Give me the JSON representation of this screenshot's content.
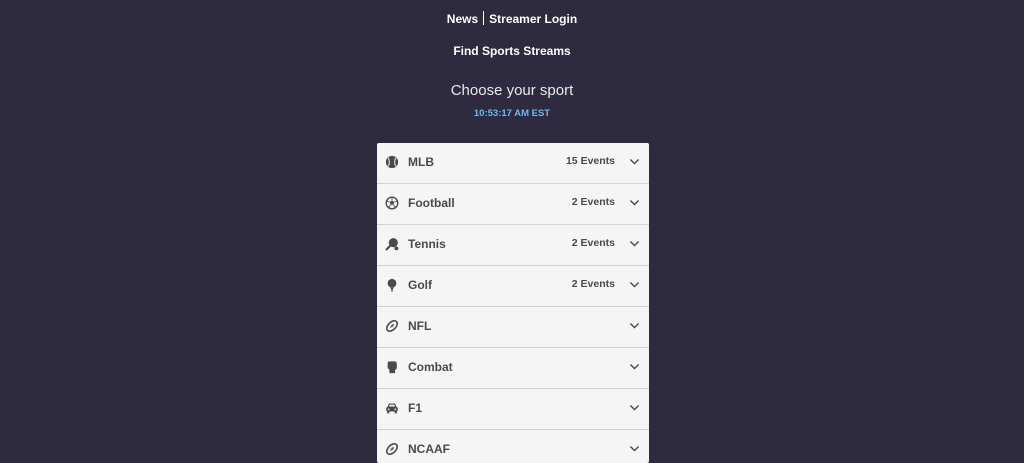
{
  "nav": {
    "news": "News",
    "streamer_login": "Streamer Login",
    "find_streams": "Find Sports Streams"
  },
  "main": {
    "heading": "Choose your sport",
    "clock": "10:53:17 AM EST"
  },
  "sports": [
    {
      "label": "MLB",
      "count": "15 Events",
      "icon": "baseball-icon"
    },
    {
      "label": "Football",
      "count": "2 Events",
      "icon": "soccer-ball-icon"
    },
    {
      "label": "Tennis",
      "count": "2 Events",
      "icon": "racket-icon"
    },
    {
      "label": "Golf",
      "count": "2 Events",
      "icon": "golf-ball-icon"
    },
    {
      "label": "NFL",
      "count": "",
      "icon": "football-icon"
    },
    {
      "label": "Combat",
      "count": "",
      "icon": "fist-icon"
    },
    {
      "label": "F1",
      "count": "",
      "icon": "car-icon"
    },
    {
      "label": "NCAAF",
      "count": "",
      "icon": "football-icon"
    }
  ],
  "colors": {
    "background": "#2e2b40",
    "panel": "#f5f5f5",
    "clock": "#6fb8f0",
    "text": "#4a4a4a"
  }
}
